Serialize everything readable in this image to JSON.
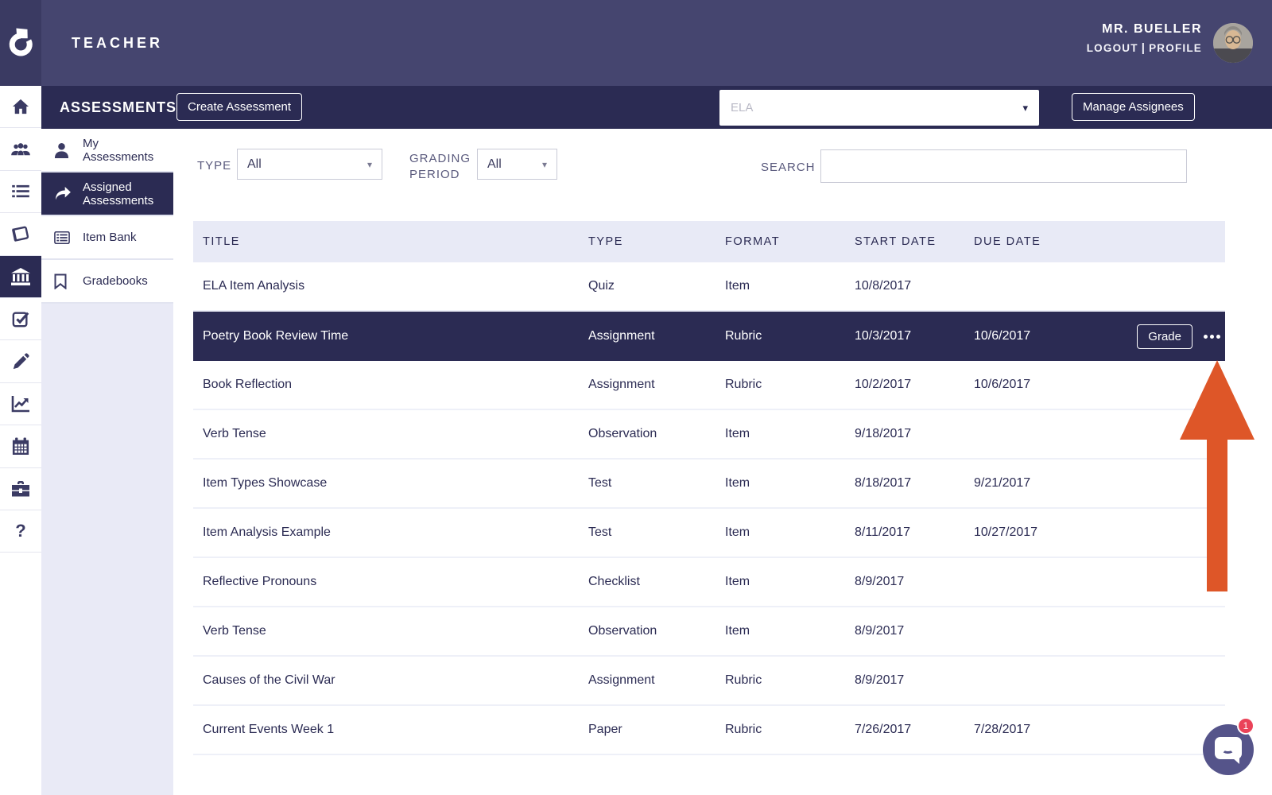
{
  "colors": {
    "topbar": "#45456F",
    "dark_navy": "#2B2B53",
    "lavender": "#E9EAF6",
    "annotation_arrow_orange": "#DE5628",
    "chat_purple": "#55548A",
    "badge_red": "#EA4359"
  },
  "topbar": {
    "app_label": "TEACHER",
    "user_name": "MR. BUELLER",
    "logout_label": "LOGOUT",
    "separator": "|",
    "profile_label": "PROFILE"
  },
  "secondary_bar": {
    "title": "ASSESSMENTS",
    "create_button_label": "Create Assessment",
    "course_select_value": "ELA",
    "manage_assignees_label": "Manage Assignees"
  },
  "icon_rail": {
    "items": [
      "home",
      "people",
      "list",
      "book",
      "bank",
      "check-square",
      "pencil",
      "line-chart",
      "calendar",
      "briefcase",
      "help"
    ],
    "active": "bank",
    "help_glyph": "?"
  },
  "sidebar": {
    "items": [
      {
        "label": "My Assessments",
        "icon": "person",
        "active": false
      },
      {
        "label": "Assigned Assessments",
        "icon": "share-arrow",
        "active": true
      },
      {
        "label": "Item Bank",
        "icon": "item-card",
        "active": false
      },
      {
        "label": "Gradebooks",
        "icon": "bookmark",
        "active": false
      }
    ]
  },
  "filters": {
    "type_label": "TYPE",
    "type_value": "All",
    "grading_period_label": "GRADING PERIOD",
    "grading_period_value": "All",
    "search_label": "SEARCH",
    "search_value": ""
  },
  "table": {
    "columns": [
      "TITLE",
      "TYPE",
      "FORMAT",
      "START DATE",
      "DUE DATE"
    ],
    "grade_button_label": "Grade",
    "rows": [
      {
        "title": "ELA Item Analysis",
        "type": "Quiz",
        "format": "Item",
        "start_date": "10/8/2017",
        "due_date": "",
        "selected": false
      },
      {
        "title": "Poetry Book Review Time",
        "type": "Assignment",
        "format": "Rubric",
        "start_date": "10/3/2017",
        "due_date": "10/6/2017",
        "selected": true
      },
      {
        "title": "Book Reflection",
        "type": "Assignment",
        "format": "Rubric",
        "start_date": "10/2/2017",
        "due_date": "10/6/2017",
        "selected": false
      },
      {
        "title": "Verb Tense",
        "type": "Observation",
        "format": "Item",
        "start_date": "9/18/2017",
        "due_date": "",
        "selected": false
      },
      {
        "title": "Item Types Showcase",
        "type": "Test",
        "format": "Item",
        "start_date": "8/18/2017",
        "due_date": "9/21/2017",
        "selected": false
      },
      {
        "title": "Item Analysis Example",
        "type": "Test",
        "format": "Item",
        "start_date": "8/11/2017",
        "due_date": "10/27/2017",
        "selected": false
      },
      {
        "title": "Reflective Pronouns",
        "type": "Checklist",
        "format": "Item",
        "start_date": "8/9/2017",
        "due_date": "",
        "selected": false
      },
      {
        "title": "Verb Tense",
        "type": "Observation",
        "format": "Item",
        "start_date": "8/9/2017",
        "due_date": "",
        "selected": false
      },
      {
        "title": "Causes of the Civil War",
        "type": "Assignment",
        "format": "Rubric",
        "start_date": "8/9/2017",
        "due_date": "",
        "selected": false
      },
      {
        "title": "Current Events Week 1",
        "type": "Paper",
        "format": "Rubric",
        "start_date": "7/26/2017",
        "due_date": "7/28/2017",
        "selected": false
      }
    ]
  },
  "chat": {
    "unread_count": "1"
  }
}
